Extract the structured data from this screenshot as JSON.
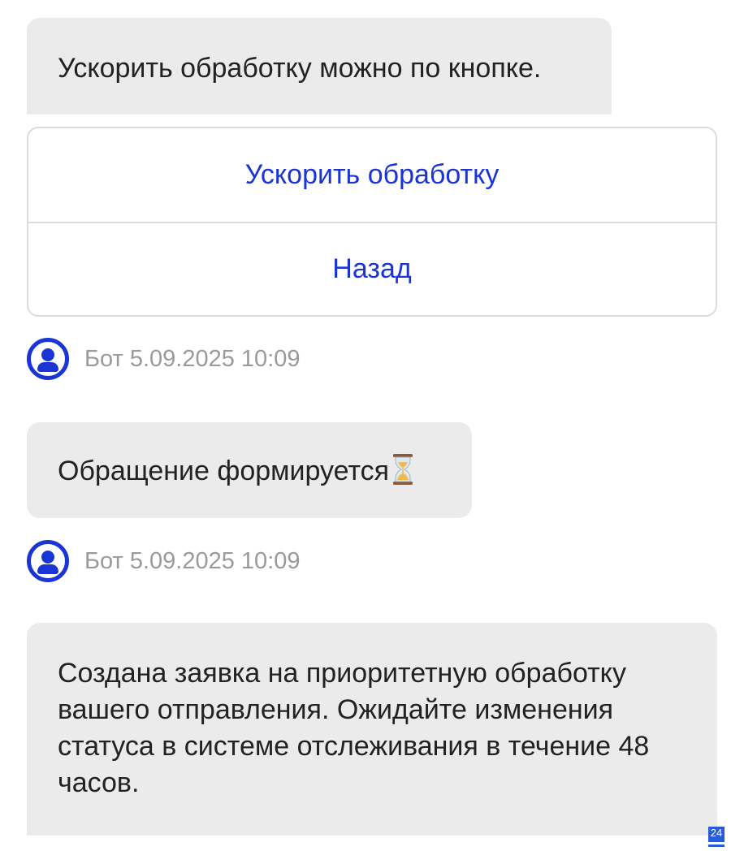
{
  "messages": {
    "prompt_text": "Ускорить обработку можно по кнопке.",
    "forming_text": "Обращение формируется",
    "forming_icon": "hourglass-icon",
    "result_text": "Создана заявка на приоритетную обработку вашего отправления. Ожидайте изменения статуса в системе отслеживания в течение 48 часов."
  },
  "buttons": {
    "speed_up_label": "Ускорить обработку",
    "back_label": "Назад"
  },
  "meta": [
    {
      "text": "Бот 5.09.2025 10:09"
    },
    {
      "text": "Бот 5.09.2025 10:09"
    }
  ],
  "corner_badge": "24",
  "colors": {
    "accent": "#1a34d6",
    "bubble_bg": "#ebebeb",
    "meta_text": "#9a9a9a"
  }
}
